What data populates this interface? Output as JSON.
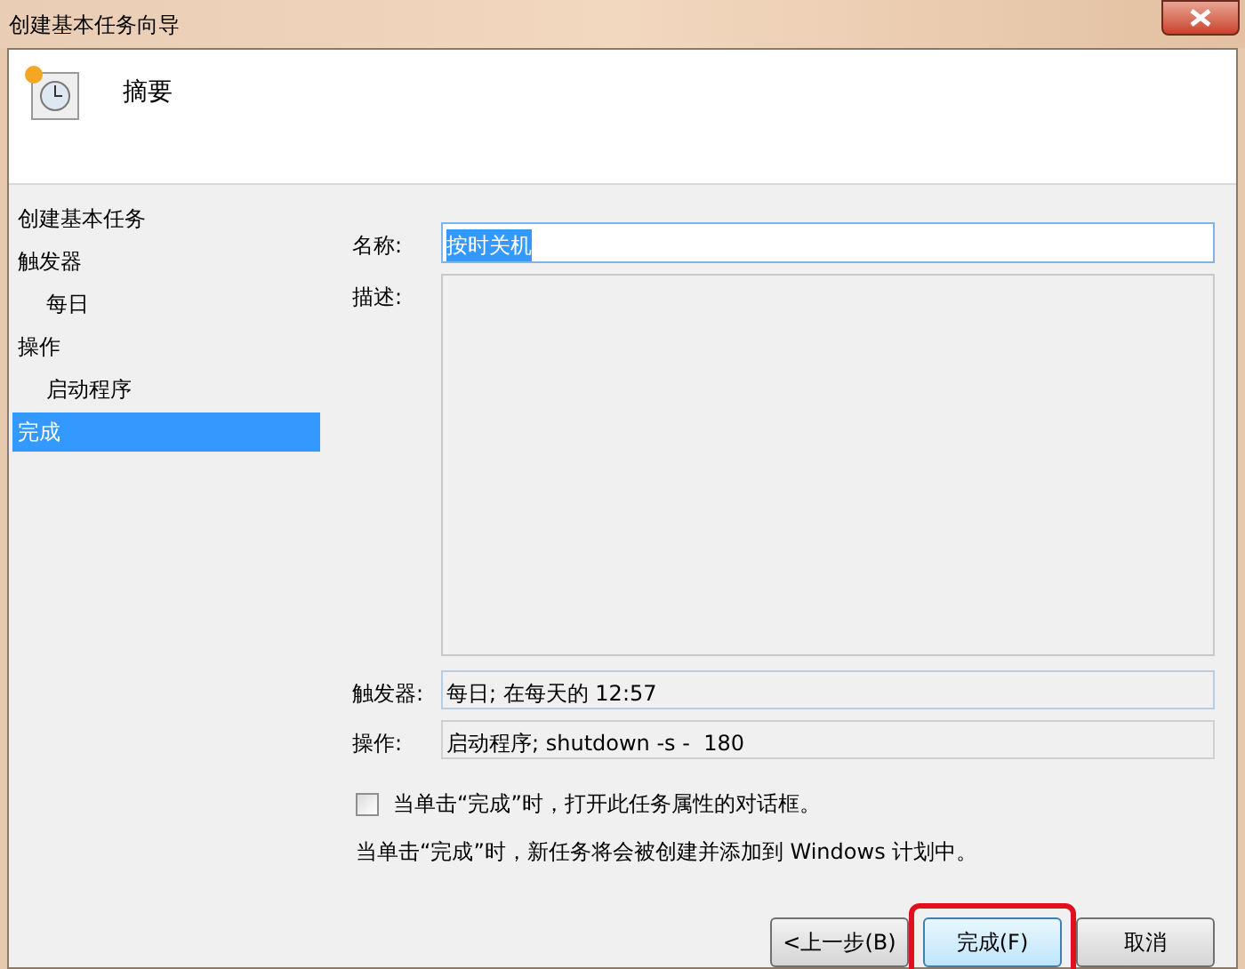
{
  "window": {
    "title": "创建基本任务向导"
  },
  "header": {
    "title": "摘要"
  },
  "nav": [
    {
      "label": "创建基本任务",
      "selected": false
    },
    {
      "label": "触发器",
      "selected": false,
      "children": [
        {
          "label": "每日",
          "selected": false
        }
      ]
    },
    {
      "label": "操作",
      "selected": false,
      "children": [
        {
          "label": "启动程序",
          "selected": false
        }
      ]
    },
    {
      "label": "完成",
      "selected": true
    }
  ],
  "fields": [
    {
      "kind": "name",
      "label": "名称:",
      "value": "按时关机",
      "selected": true
    },
    {
      "kind": "description",
      "label": "描述:"
    },
    {
      "kind": "trigger",
      "label": "触发器:",
      "value": "每日; 在每天的 12:57"
    },
    {
      "kind": "action",
      "label": "操作:",
      "value": "启动程序; shutdown -s -  180"
    }
  ],
  "open_properties": {
    "label": "当单击“完成”时，打开此任务属性的对话框。",
    "checked": false
  },
  "note": "当单击“完成”时，新任务将会被创建并添加到 Windows 计划中。",
  "buttons": [
    {
      "label": "<上一步(B)",
      "kind": "normal",
      "highlighted": false
    },
    {
      "label": "完成(F)",
      "kind": "default",
      "highlighted": true
    },
    {
      "label": "取消",
      "kind": "normal",
      "highlighted": false
    }
  ]
}
